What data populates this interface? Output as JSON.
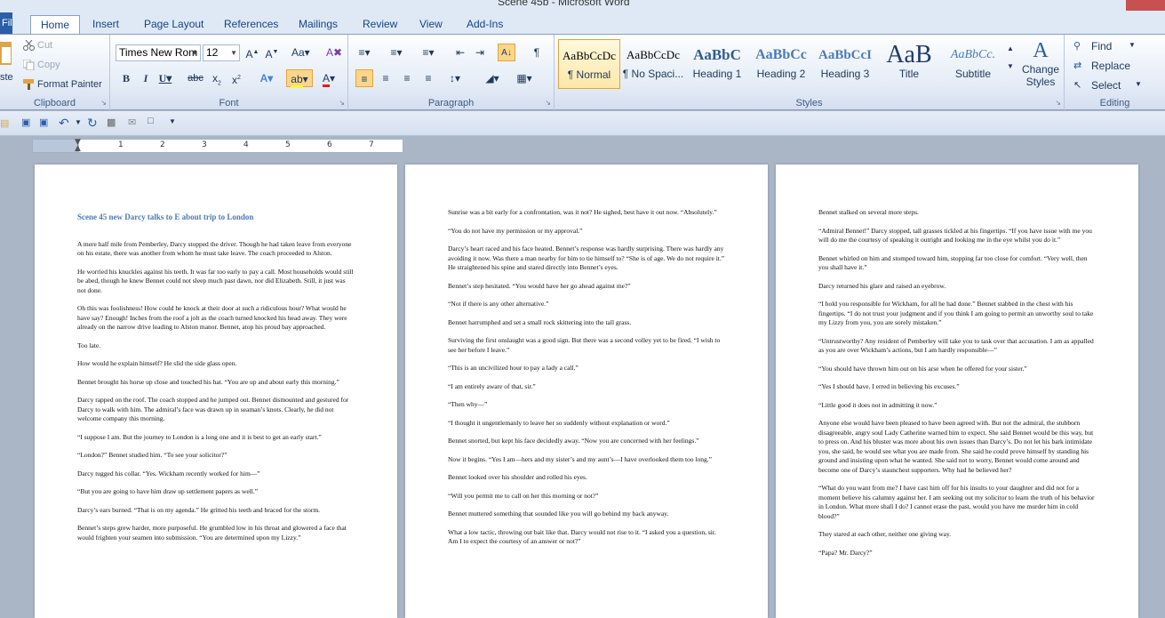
{
  "window": {
    "title": "Scene 45b  -  Microsoft Word"
  },
  "tabs": [
    "File",
    "Home",
    "Insert",
    "Page Layout",
    "References",
    "Mailings",
    "Review",
    "View",
    "Add-Ins"
  ],
  "clipboard": {
    "paste": "ste",
    "cut": "Cut",
    "copy": "Copy",
    "format_painter": "Format Painter",
    "label": "Clipboard"
  },
  "font": {
    "name": "Times New Rom",
    "size": "12",
    "label": "Font"
  },
  "paragraph": {
    "label": "Paragraph"
  },
  "styles": {
    "label": "Styles",
    "items": [
      {
        "sample": "AaBbCcDc",
        "name": "¶ Normal"
      },
      {
        "sample": "AaBbCcDc",
        "name": "¶ No Spaci..."
      },
      {
        "sample": "AaBbC",
        "name": "Heading 1"
      },
      {
        "sample": "AaBbCc",
        "name": "Heading 2"
      },
      {
        "sample": "AaBbCcI",
        "name": "Heading 3"
      },
      {
        "sample": "AaB",
        "name": "Title"
      },
      {
        "sample": "AaBbCc.",
        "name": "Subtitle"
      }
    ],
    "change_styles": "Change Styles"
  },
  "editing": {
    "find": "Find",
    "replace": "Replace",
    "select": "Select",
    "label": "Editing"
  },
  "ruler": {
    "n1": "1",
    "n2": "2",
    "n3": "3",
    "n4": "4",
    "n5": "5",
    "n6": "6",
    "n7": "7"
  },
  "colors": {
    "accent": "#2a5ea8",
    "ribbon_bg": "#dfe9f5",
    "page_bg": "#aab6c6",
    "heading_blue": "#4a7ab8"
  },
  "page1": {
    "heading": "Scene 45 new Darcy talks to E about trip to London",
    "p1": "A mere half mile from Pemberley, Darcy stopped the driver. Though he had taken leave from everyone on his estate, there was another from whom he must take leave. The coach proceeded to Alston.",
    "p2": "He worried his knuckles against his teeth. It was far too early to pay a call. Most households would still be abed, though he knew Bennet could not sleep much past dawn, nor did Elizabeth. Still, it just was not done.",
    "p3": "Oh this was foolishness! How could he knock at their door at such a ridiculous hour? What would he have say? Enough! Inches from the roof a jolt as the coach turned knocked his head away. They were already on the narrow drive leading to Alston manor. Bennet, atop his proud bay approached.",
    "p4": "Too late.",
    "p5": "How would he explain himself? He slid the side glass open.",
    "p6": "Bennet brought his horse up close and touched his hat. “You are up and about early this morning.”",
    "p7": "Darcy rapped on the roof. The coach stopped and he jumped out. Bennet dismounted and gestured for Darcy to walk with him. The admiral’s face was drawn up in seaman’s knots. Clearly, he did not welcome company this morning.",
    "p8": "“I suppose I am. But the journey to London is a long one and it is best to get an early start.”",
    "p9": "“London?” Bennet studied him. “To see your solicitor?”",
    "p10": "Darcy tugged his collar. “Yes. Wickham recently worked for him—”",
    "p11": "“But you are going to have him draw up settlement papers as well.”",
    "p12": "Darcy’s ears burned. “That is on my agenda.” He gritted his teeth and braced for the storm.",
    "p13": "Bennet’s steps grew harder, more purposeful. He grumbled low in his throat and glowered a face that would frighten your seamen into submission. “You are determined upon my Lizzy.”"
  },
  "page2": {
    "p1": "Sunrise was a bit early for a confrontation, was it not? He sighed, best have it out now. “Absolutely.”",
    "p2": "“You do not have my permission or my approval.”",
    "p3": "Darcy’s heart raced and his face heated. Bennet’s response was hardly surprising. There was hardly any avoiding it now. Was there a man nearby for him to tie himself to? “She is of age. We do not require it.” He straightened his spine and stared directly into Bennet’s eyes.",
    "p4": "Bennet’s step hesitated. “You would have her go ahead against me?”",
    "p5": "“Not if there is any other alternative.”",
    "p6": "Bennet harrumphed and set a small rock skittering into the tall grass.",
    "p7": "Surviving the first onslaught was a good sign. But there was a second volley yet to be fired. “I wish to see her before I leave.”",
    "p8": "“This is an uncivilized hour to pay a lady a call.”",
    "p9": "“I am entirely aware of that, sir.”",
    "p10": "“Then why—”",
    "p11": " “I thought it ungentlemanly to leave her so suddenly without explanation or word.”",
    "p12": "Bennet snorted, but kept his face decidedly away. “Now you are concerned with her feelings.”",
    "p13": "Now it begins. “Yes I am—hers and my sister’s and my aunt’s—I have overlooked them too long.”",
    "p14": "Bennet looked over his shoulder and rolled his eyes.",
    "p15": "“Will you permit me to call on her this morning or not?”",
    "p16": "Bennet muttered something that sounded like you will go behind my back anyway.",
    "p17": "What a low tactic, throwing out bait like that. Darcy would not rise to it. “I asked you a question, sir. Am I to expect the courtesy of an answer or not?”"
  },
  "page3": {
    "p1": "Bennet stalked on several more steps.",
    "p2": "“Admiral Bennet!” Darcy stopped, tall grasses tickled at his fingertips. “If you have issue with me you will do me the courtesy of speaking it outright and looking me in the eye whilst you do it.”",
    "p3": "Bennet whirled on him and stomped toward him, stopping far too close for comfort. “Very well, then you shall have it.”",
    "p4": "Darcy returned his glare and raised an eyebrow.",
    "p5": "“I hold you responsible for Wickham, for all he had done.” Bennet stabbed in the chest with his fingertips. “I do not trust your judgment and if you think I am going to permit an unworthy soul to take my Lizzy from you, you are sorely mistaken.”",
    "p6": "“Untrustworthy? Any resident of Pemberley will take you to task over that accusation. I am as appalled as you are over Wickham’s actions, but I am hardly responsible—”",
    "p7": "“You should have thrown him out on his arse when he offered for your sister.”",
    "p8": "“Yes I should have. I erred in believing his excuses.”",
    "p9": "“Little good it does not in admitting it now.”",
    "p10": "Anyone else would have been pleased to have been agreed with. But not the admiral, the stubborn disagreeable, angry soul Lady Catherine warned him to expect. She said Bennet would be this way, but to press on. And his bluster was more about his own issues than Darcy’s. Do not let his bark intimidate you, she said, he would see what you are made from. She said he could prove himself by standing his ground and insisting upon what he wanted.  She said not to worry, Bennet would come around and become one of Darcy’s staunchest supporters.  Why had he believed her?",
    "p11": "“What do you want from me? I have cast him off for his insults to your daughter and did not for a moment believe his calumny against her. I am seeking out my solicitor to learn the truth of his behavior in London. What more shall I do? I cannot erase the past, would you have me murder him in cold blood?”",
    "p12": "They stared at each other, neither one giving way.",
    "p13": "“Papa? Mr. Darcy?”"
  }
}
